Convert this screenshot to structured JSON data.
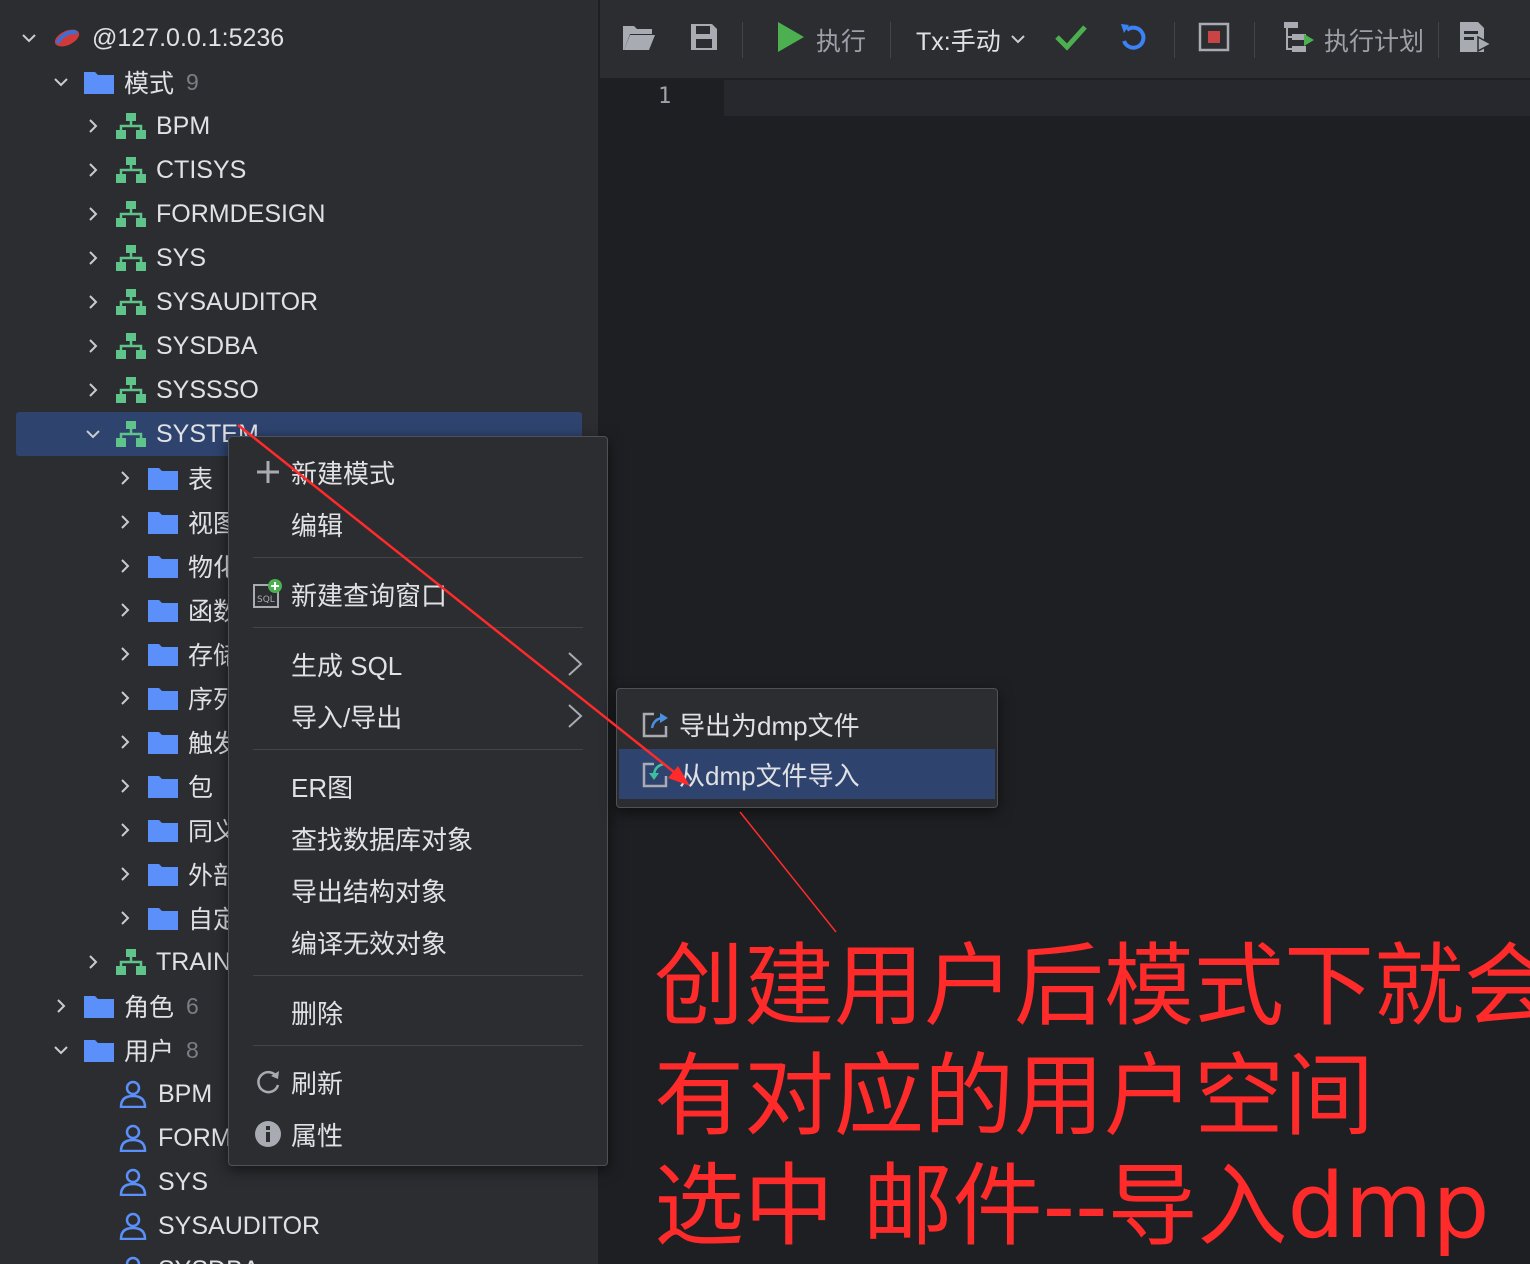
{
  "tree": {
    "connection": "@127.0.0.1:5236",
    "schemas_folder": {
      "label": "模式",
      "count": "9"
    },
    "schemas": [
      "BPM",
      "CTISYS",
      "FORMDESIGN",
      "SYS",
      "SYSAUDITOR",
      "SYSDBA",
      "SYSSSO",
      "SYSTEM"
    ],
    "system_children": [
      "表",
      "视图",
      "物化",
      "函数",
      "存储",
      "序列",
      "触发",
      "包",
      "同义",
      "外部",
      "自定"
    ],
    "after_system": "TRAIN",
    "roles_folder": {
      "label": "角色",
      "count": "6"
    },
    "users_folder": {
      "label": "用户",
      "count": "8"
    },
    "users": [
      "BPM",
      "FORM",
      "SYS",
      "SYSAUDITOR",
      "SYSDBA"
    ]
  },
  "toolbar": {
    "execute": "执行",
    "tx_mode": "Tx:手动",
    "explain_plan": "执行计划"
  },
  "editor": {
    "line_number": "1"
  },
  "context_menu": {
    "items": [
      "新建模式",
      "编辑",
      "新建查询窗口",
      "生成 SQL",
      "导入/导出",
      "ER图",
      "查找数据库对象",
      "导出结构对象",
      "编译无效对象",
      "删除",
      "刷新",
      "属性"
    ]
  },
  "submenu": {
    "export_dmp": "导出为dmp文件",
    "import_dmp": "从dmp文件导入"
  },
  "annotation": {
    "line1": "创建用户后模式下就会",
    "line2": "有对应的用户空间",
    "line3": "选中 邮件--导入dmp"
  },
  "colors": {
    "selection": "#2e436e",
    "schema_icon": "#5fc48a",
    "folder_icon": "#5b8ff9",
    "annotation": "#ff2a2a",
    "run_green": "#4cb050"
  }
}
